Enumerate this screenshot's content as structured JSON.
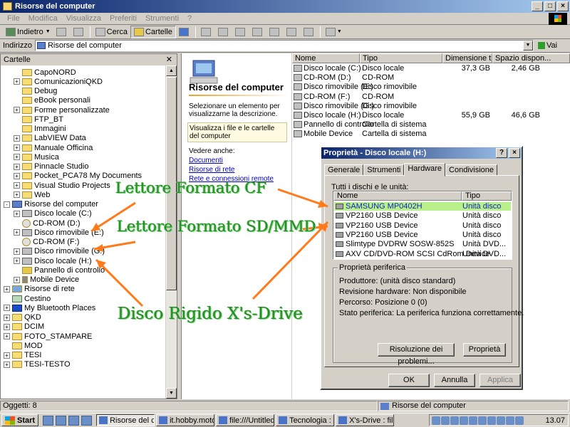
{
  "window": {
    "title": "Risorse del computer"
  },
  "menu": [
    "File",
    "Modifica",
    "Visualizza",
    "Preferiti",
    "Strumenti",
    "?"
  ],
  "toolbar": {
    "back": "Indietro",
    "search": "Cerca",
    "folders": "Cartelle"
  },
  "address": {
    "label": "Indirizzo",
    "value": "Risorse del computer",
    "go": "Vai"
  },
  "folders_pane": {
    "title": "Cartelle",
    "items": [
      {
        "label": "CapoNORD",
        "icon": "folder-icon"
      },
      {
        "label": "ComunicazioniQKD",
        "icon": "folder-icon"
      },
      {
        "label": "Debug",
        "icon": "folder-icon"
      },
      {
        "label": "eBook personali",
        "icon": "folder-icon"
      },
      {
        "label": "Forme personalizzate",
        "icon": "folder-icon"
      },
      {
        "label": "FTP_BT",
        "icon": "folder-icon"
      },
      {
        "label": "Immagini",
        "icon": "folder-icon"
      },
      {
        "label": "LabVIEW Data",
        "icon": "folder-icon"
      },
      {
        "label": "Manuale Officina",
        "icon": "folder-icon"
      },
      {
        "label": "Musica",
        "icon": "folder-icon"
      },
      {
        "label": "Pinnacle Studio",
        "icon": "folder-icon"
      },
      {
        "label": "Pocket_PCA78 My Documents",
        "icon": "folder-icon"
      },
      {
        "label": "Visual Studio Projects",
        "icon": "folder-icon"
      },
      {
        "label": "Web",
        "icon": "folder-icon"
      },
      {
        "label": "Risorse del computer",
        "icon": "computer-icon"
      },
      {
        "label": "Disco locale (C:)",
        "icon": "hard-drive-icon"
      },
      {
        "label": "CD-ROM (D:)",
        "icon": "cd-drive-icon"
      },
      {
        "label": "Disco rimovibile (E:)",
        "icon": "removable-drive-icon"
      },
      {
        "label": "CD-ROM (F:)",
        "icon": "cd-drive-icon"
      },
      {
        "label": "Disco rimovibile (G:)",
        "icon": "removable-drive-icon"
      },
      {
        "label": "Disco locale (H:)",
        "icon": "hard-drive-icon"
      },
      {
        "label": "Pannello di controllo",
        "icon": "control-panel-icon"
      },
      {
        "label": "Mobile Device",
        "icon": "mobile-device-icon"
      },
      {
        "label": "Risorse di rete",
        "icon": "network-icon"
      },
      {
        "label": "Cestino",
        "icon": "recycle-bin-icon"
      },
      {
        "label": "My Bluetooth Places",
        "icon": "bluetooth-icon"
      },
      {
        "label": "QKD",
        "icon": "folder-icon"
      },
      {
        "label": "DCIM",
        "icon": "folder-icon"
      },
      {
        "label": "FOTO_STAMPARE",
        "icon": "folder-icon"
      },
      {
        "label": "MOD",
        "icon": "folder-icon"
      },
      {
        "label": "TESI",
        "icon": "folder-icon"
      },
      {
        "label": "TESI-TESTO",
        "icon": "folder-icon"
      }
    ]
  },
  "webview": {
    "title": "Risorse del computer",
    "desc": "Selezionare un elemento per visualizzarne la descrizione.",
    "hint": "Visualizza i file e le cartelle del computer",
    "see_also": "Vedere anche:",
    "links": [
      "Documenti",
      "Risorse di rete",
      "Rete e connessioni remote"
    ]
  },
  "filelist": {
    "columns": [
      "Nome",
      "Tipo",
      "Dimensione t...",
      "Spazio dispon..."
    ],
    "rows": [
      {
        "name": "Disco locale (C:)",
        "type": "Disco locale",
        "size": "37,3 GB",
        "free": "2,46 GB"
      },
      {
        "name": "CD-ROM (D:)",
        "type": "CD-ROM",
        "size": "",
        "free": ""
      },
      {
        "name": "Disco rimovibile (E:)",
        "type": "Disco rimovibile",
        "size": "",
        "free": ""
      },
      {
        "name": "CD-ROM (F:)",
        "type": "CD-ROM",
        "size": "",
        "free": ""
      },
      {
        "name": "Disco rimovibile (G:)",
        "type": "Disco rimovibile",
        "size": "",
        "free": ""
      },
      {
        "name": "Disco locale (H:)",
        "type": "Disco locale",
        "size": "55,9 GB",
        "free": "46,6 GB"
      },
      {
        "name": "Pannello di controllo",
        "type": "Cartella di sistema",
        "size": "",
        "free": ""
      },
      {
        "name": "Mobile Device",
        "type": "Cartella di sistema",
        "size": "",
        "free": ""
      }
    ]
  },
  "status": {
    "objects": "Oggetti: 8",
    "location": "Risorse del computer"
  },
  "dialog": {
    "title": "Proprietà - Disco locale (H:)",
    "tabs": [
      "Generale",
      "Strumenti",
      "Hardware",
      "Condivisione"
    ],
    "devices_label": "Tutti i dischi e le unità:",
    "columns": [
      "Nome",
      "Tipo"
    ],
    "devices": [
      {
        "name": "SAMSUNG MP0402H",
        "type": "Unità disco"
      },
      {
        "name": "VP2160 USB Device",
        "type": "Unità disco"
      },
      {
        "name": "VP2160 USB Device",
        "type": "Unità disco"
      },
      {
        "name": "VP2160 USB Device",
        "type": "Unità disco"
      },
      {
        "name": "Slimtype DVDRW SOSW-852S",
        "type": "Unità DVD..."
      },
      {
        "name": "AXV CD/DVD-ROM SCSI CdRom Device",
        "type": "Unità DVD..."
      }
    ],
    "group_title": "Proprietà periferica",
    "manufacturer": "Produttore: (unità disco standard)",
    "revision": "Revisione hardware: Non disponibile",
    "location": "Percorso: Posizione 0 (0)",
    "device_status": "Stato periferica: La periferica funziona correttamente.",
    "troubleshoot": "Risoluzione dei problemi...",
    "properties": "Proprietà",
    "ok": "OK",
    "cancel": "Annulla",
    "apply": "Applica"
  },
  "annotations": {
    "cf": "Lettore Formato CF",
    "sd": "Lettore Formato SD/MMD",
    "hd": "Disco Rigido X's-Drive",
    "color": "#2a8a2a"
  },
  "taskbar": {
    "start": "Start",
    "tasks": [
      "Risorse del co...",
      "it.hobby.motoc...",
      "file:///Untitled ...",
      "Tecnologia : fil...",
      "X's-Drive : file:..."
    ],
    "clock": "13.07"
  }
}
